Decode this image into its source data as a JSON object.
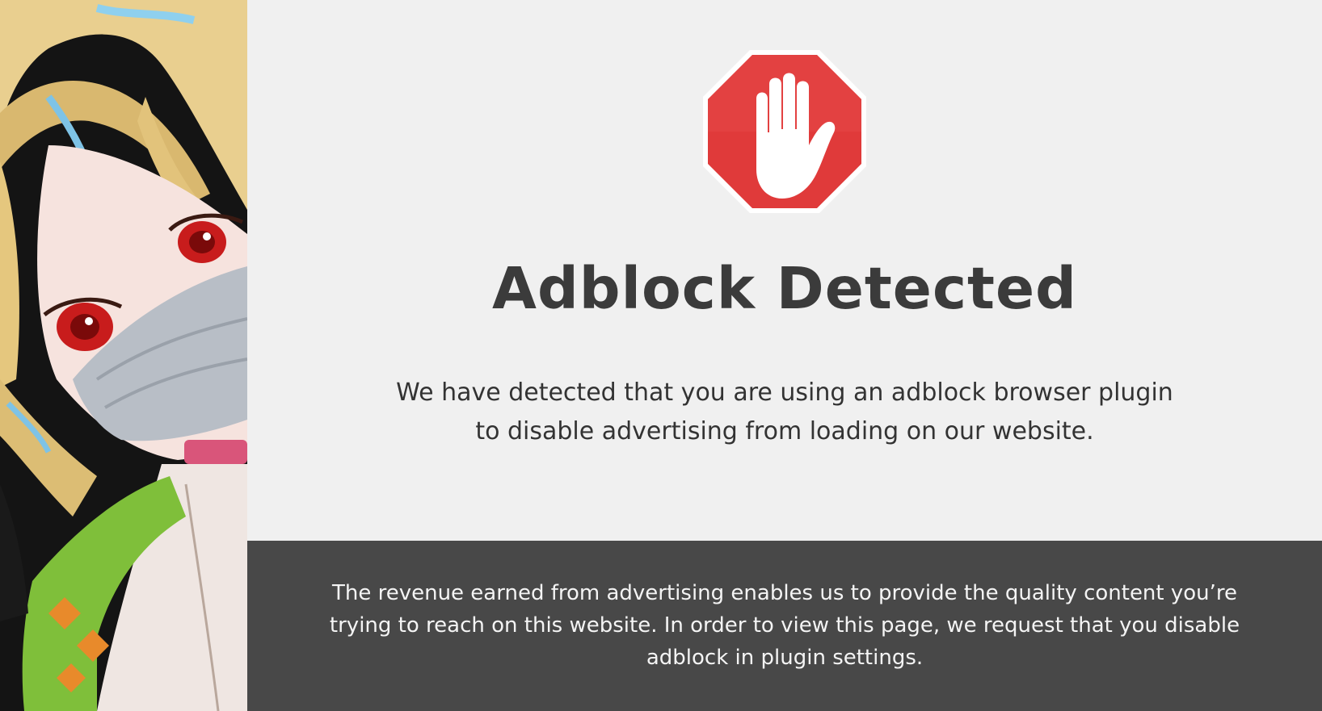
{
  "notice": {
    "headline": "Adblock Detected",
    "message": "We have detected that you are using an adblock browser plugin to disable advertising from loading on our website.",
    "footer_text": "The revenue earned from advertising enables us to provide the quality content you’re trying to reach on this website. In order to view this page, we request that you disable adblock in plugin settings."
  },
  "icons": {
    "stop_sign": "stop-hand-icon",
    "character_art": "masked-anime-character-illustration"
  },
  "colors": {
    "stop_red": "#e03a3a",
    "page_bg": "#f0f0f0",
    "footer_bg": "#484848",
    "headline": "#3b3b3b"
  }
}
